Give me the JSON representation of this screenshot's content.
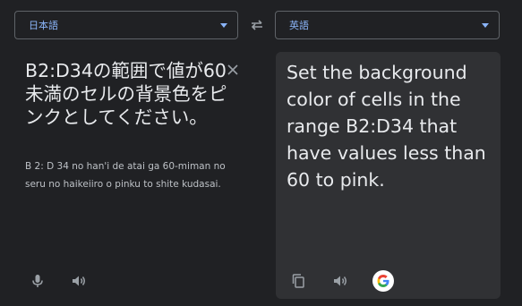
{
  "source_lang": {
    "label": "日本語"
  },
  "target_lang": {
    "label": "英語"
  },
  "source": {
    "text": "B2:D34の範囲で値が60未満のセルの背景色をピンクとしてください。",
    "romanization": "B 2: D 34 no han'i de atai ga 60-miman no seru no haikeiiro o pinku to shite kudasai."
  },
  "target": {
    "text": "Set the background color of cells in the range B2:D34 that have values less than 60 to pink."
  },
  "icons": {
    "swap": "swap-arrows-icon",
    "clear": "close-icon",
    "mic": "microphone-icon",
    "speaker": "speaker-icon",
    "copy": "copy-icon",
    "google": "google-logo"
  },
  "colors": {
    "background": "#202124",
    "panel": "#303134",
    "accent": "#8ab4f8",
    "text": "#e8eaed",
    "icon": "#9aa0a6"
  }
}
